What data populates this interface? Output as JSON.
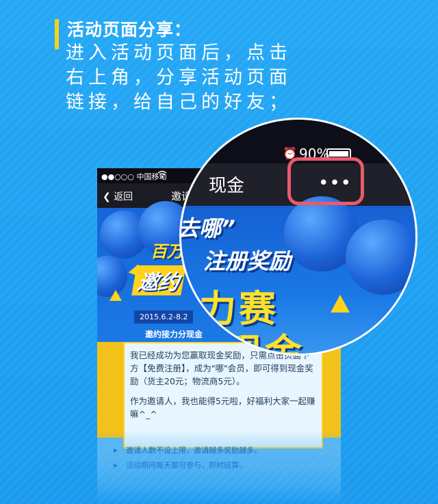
{
  "heading": {
    "title": "活动页面分享：",
    "description": "进入活动页面后，点击右上角，分享活动页面链接，给自己的好友；"
  },
  "phone": {
    "status": {
      "signal": "●●○○○ 中国移动",
      "wifi_icon": "wifi-icon"
    },
    "nav": {
      "back": "返回",
      "title": "邀请"
    },
    "poster": {
      "banner_hundred": "百万",
      "banner_invite": "邀约",
      "date": "2015.6.2-8.2",
      "slogan": "邀约接力分现金",
      "message_p1": "我已经成功为您赢取现金奖励，只需点击页面下方【免费注册】，成为\"哪\"会员，即可得到现金奖励（货主20元；物流商5元）。",
      "message_p2": "作为邀请人，我也能得5元啦，好福利大家一起赚嘛^_^",
      "rules": [
        "邀请人数不设上限，邀请越多奖励越多。",
        "活动期间每天都可参与，即时结算。"
      ]
    }
  },
  "magnifier": {
    "battery": "90%",
    "nav_title": "现金",
    "more_label": "•••",
    "poster_line1": "去哪”",
    "poster_line2": "注册奖励",
    "poster_big1": "力赛",
    "poster_big2": "现金"
  },
  "colors": {
    "background": "#1e9ff0",
    "accent": "#f7d21a",
    "highlight": "#ea5a6a"
  }
}
